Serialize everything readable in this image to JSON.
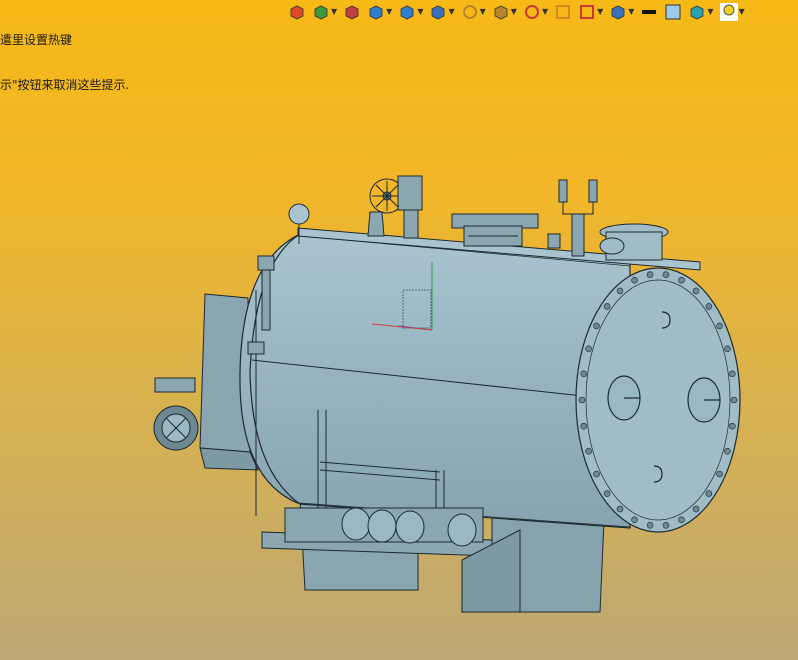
{
  "hint": {
    "line1": "遣里设置热键",
    "line2": "示\"按钮来取消这些提示."
  },
  "toolbar": {
    "buttons": [
      {
        "name": "previous-view-icon",
        "dropdown": false,
        "color": "#e04a2a"
      },
      {
        "name": "dynamic-annotation-icon",
        "dropdown": true,
        "color": "#3b9a3b"
      },
      {
        "name": "section-view-icon",
        "dropdown": false,
        "color": "#c04040"
      },
      {
        "name": "view-orientation-icon",
        "dropdown": true,
        "color": "#2c7fd0"
      },
      {
        "name": "display-style-icon",
        "dropdown": true,
        "color": "#2c7fd0"
      },
      {
        "name": "hide-show-items-icon",
        "dropdown": true,
        "color": "#3b6fc0"
      },
      {
        "name": "edit-appearance-icon",
        "dropdown": true,
        "color": "#b8862a"
      },
      {
        "name": "apply-scene-icon",
        "dropdown": true,
        "color": "#b8862a"
      },
      {
        "name": "view-settings-icon",
        "dropdown": true,
        "color": "#c83a3a"
      },
      {
        "name": "rotate-view-icon",
        "dropdown": false,
        "color": "#d08a20"
      },
      {
        "name": "zoom-to-fit-icon",
        "dropdown": true,
        "color": "#c83a3a"
      },
      {
        "name": "monitor-icon",
        "dropdown": true,
        "color": "#3b6fc0"
      },
      {
        "name": "line-color-icon",
        "dropdown": false,
        "color": "#111111"
      },
      {
        "name": "plain-view-icon",
        "dropdown": false,
        "color": "#9ecae8"
      },
      {
        "name": "layer-icon",
        "dropdown": true,
        "color": "#2aa0b0"
      },
      {
        "name": "lightbulb-icon",
        "dropdown": true,
        "color": "#f5d020"
      }
    ]
  },
  "model": {
    "body_color": "#9ab8c4",
    "edge_color": "#1c2a30",
    "dark_color": "#6e8893"
  }
}
